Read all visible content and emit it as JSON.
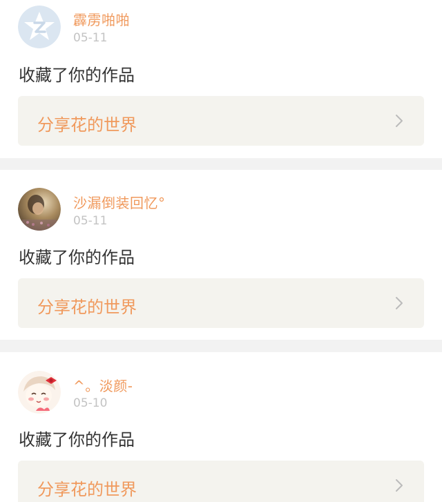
{
  "feed": {
    "items": [
      {
        "user_name": "霹雳啪啪",
        "date": "05-11",
        "action": "收藏了你的作品",
        "work_title": "分享花的世界",
        "avatar_icon": "default-star-avatar-icon"
      },
      {
        "user_name": "沙漏倒装回忆°",
        "date": "05-11",
        "action": "收藏了你的作品",
        "work_title": "分享花的世界",
        "avatar_icon": "photo-avatar-icon"
      },
      {
        "user_name": "^。淡颜-",
        "date": "05-10",
        "action": "收藏了你的作品",
        "work_title": "分享花的世界",
        "avatar_icon": "cartoon-girl-avatar-icon"
      }
    ]
  },
  "colors": {
    "accent": "#f0995c",
    "date": "#c3c3c3",
    "text": "#333333",
    "work_box_bg": "#f4f3ee",
    "divider": "#f2f2f2"
  }
}
